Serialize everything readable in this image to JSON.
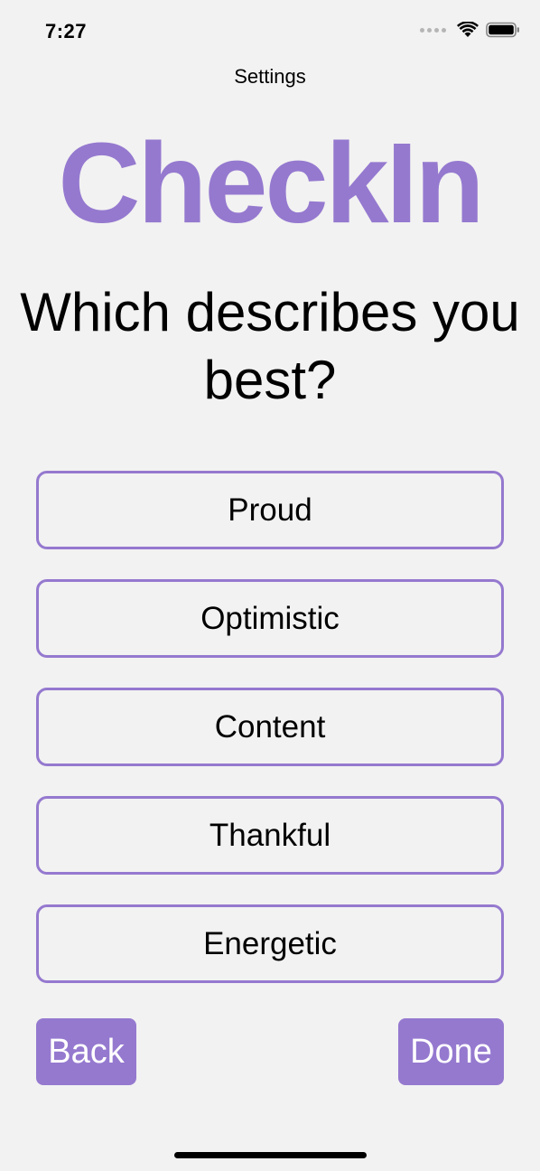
{
  "status_bar": {
    "time": "7:27"
  },
  "nav": {
    "title": "Settings"
  },
  "app": {
    "title": "CheckIn",
    "accent_color": "#9579cf"
  },
  "question": {
    "text": "Which describes you best?"
  },
  "options": [
    {
      "label": "Proud"
    },
    {
      "label": "Optimistic"
    },
    {
      "label": "Content"
    },
    {
      "label": "Thankful"
    },
    {
      "label": "Energetic"
    }
  ],
  "actions": {
    "back_label": "Back",
    "done_label": "Done"
  },
  "icons": {
    "signal": "cellular-signal-icon",
    "wifi": "wifi-icon",
    "battery": "battery-icon"
  }
}
